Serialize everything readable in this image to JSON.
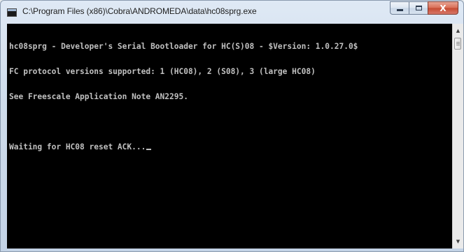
{
  "window": {
    "title": "C:\\Program Files (x86)\\Cobra\\ANDROMEDA\\data\\hc08sprg.exe",
    "icon": "console-window-icon",
    "buttons": {
      "minimize": "minimize-icon",
      "maximize": "maximize-icon",
      "close": "X"
    }
  },
  "console": {
    "lines": [
      "hc08sprg - Developer's Serial Bootloader for HC(S)08 - $Version: 1.0.27.0$",
      "FC protocol versions supported: 1 (HC08), 2 (S08), 3 (large HC08)",
      "See Freescale Application Note AN2295.",
      "",
      "Waiting for HC08 reset ACK..."
    ],
    "background": "#000000",
    "foreground": "#c0c0c0"
  },
  "scrollbar": {
    "up_arrow": "▲",
    "down_arrow": "▼"
  }
}
